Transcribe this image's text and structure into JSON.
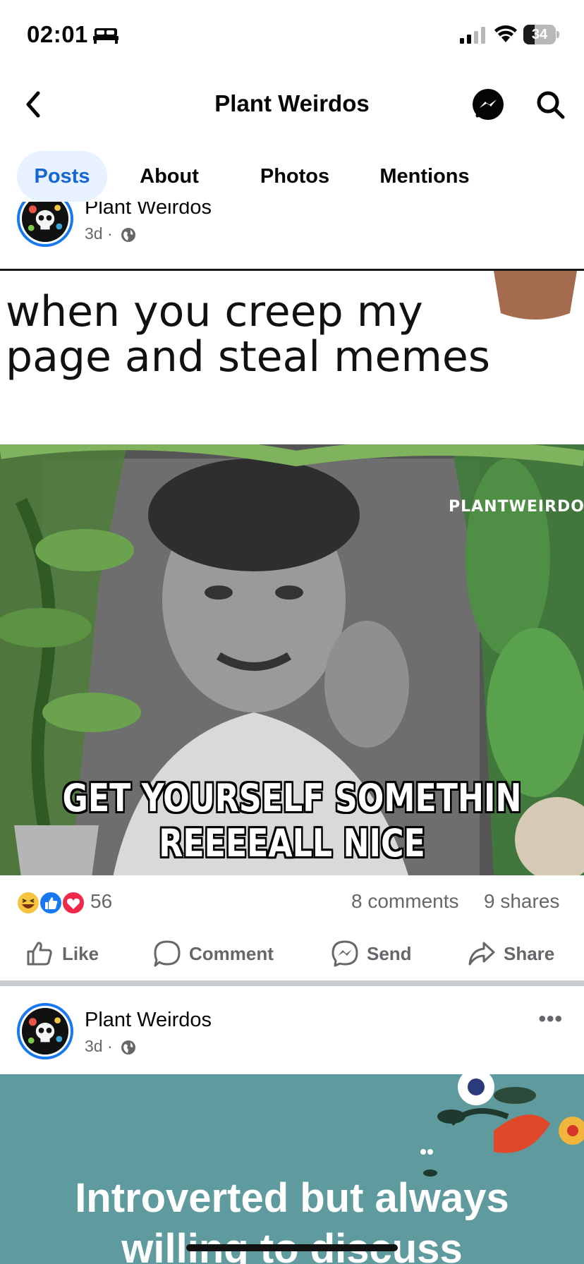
{
  "status_bar": {
    "time": "02:01",
    "battery_level": "34",
    "battery_fraction": 0.34
  },
  "header": {
    "title": "Plant Weirdos",
    "back_icon": "chevron-left-icon",
    "messenger_icon": "messenger-icon",
    "search_icon": "search-icon"
  },
  "tabs": [
    {
      "label": "Posts",
      "active": true
    },
    {
      "label": "About",
      "active": false
    },
    {
      "label": "Photos",
      "active": false
    },
    {
      "label": "Mentions",
      "active": false
    }
  ],
  "post1": {
    "author": "Plant Weirdos",
    "time": "3d",
    "meme_caption": "when you creep my page and steal memes",
    "meme_watermark": "PLANTWEIRDOS",
    "meme_bottom_line1": "GET YOURSELF SOMETHIN",
    "meme_bottom_line2": "REEEEALL NICE",
    "reaction_count": "56",
    "comments": "8 comments",
    "shares": "9 shares"
  },
  "actions": {
    "like": "Like",
    "comment": "Comment",
    "send": "Send",
    "share": "Share"
  },
  "post2": {
    "author": "Plant Weirdos",
    "time": "3d",
    "image_text_line1": "Introverted but always",
    "image_text_line2": "willing to discuss"
  },
  "colors": {
    "accent": "#1877f2",
    "tab_active_bg": "#e7f1ff",
    "tab_active_text": "#1466d0",
    "secondary_text": "#65676b",
    "post2_bg": "#5f9a9e"
  }
}
